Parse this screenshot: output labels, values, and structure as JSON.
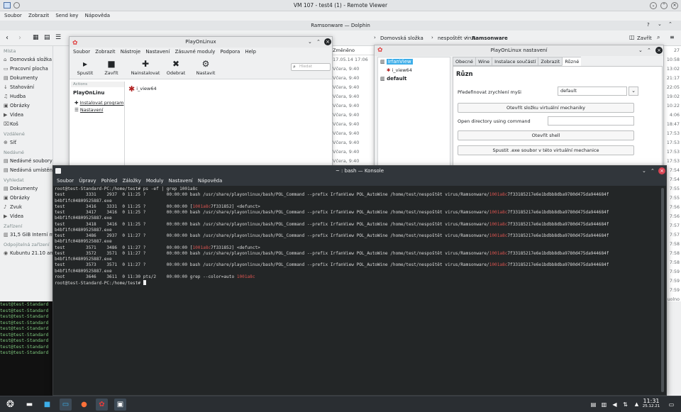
{
  "remote_viewer": {
    "title": "VM 107 - test4 (1) - Remote Viewer",
    "menu": [
      "Soubor",
      "Zobrazit",
      "Send key",
      "Nápověda"
    ]
  },
  "dolphin": {
    "title": "Ramsonware — Dolphin",
    "breadcrumb": [
      "Domovská složka",
      "nespoštět virus",
      "Ramsonware"
    ],
    "close_label": "Zavřít",
    "column_header": "Změněno",
    "sidebar": {
      "places_heading": "Místa",
      "places": [
        "Domovská složka",
        "Pracovní plocha",
        "Dokumenty",
        "Stahování",
        "Hudba",
        "Obrázky",
        "Videa",
        "Koš"
      ],
      "remote_heading": "Vzdálené",
      "remote": [
        "Síť"
      ],
      "recent_heading": "Nedávné",
      "recent": [
        "Nedávné soubory",
        "Nedávná umístění"
      ],
      "search_heading": "Vyhledat",
      "search": [
        "Dokumenty",
        "Obrázky",
        "Zvuk",
        "Videa"
      ],
      "devices_heading": "Zařízení",
      "devices": [
        "31,5 GiB Interní m"
      ],
      "removable_heading": "Odpojitelná zařízení",
      "removable": [
        "Kubuntu 21.10 am"
      ]
    },
    "modified_dates": [
      "17.05.14 17:06",
      "Včera, 9:40",
      "Včera, 9:40",
      "Včera, 9:40",
      "Včera, 9:40",
      "Včera, 9:40",
      "Včera, 9:40",
      "Včera, 9:40",
      "Včera, 9:40",
      "Včera, 9:40",
      "Včera, 9:40",
      "Včera, 9:40",
      "Včera, 9:40"
    ],
    "right_times": [
      "27",
      "10:58",
      "13:02",
      "21:17",
      "22:05",
      "19:02",
      "10:22",
      "4:06",
      "18:47",
      "17:53",
      "17:53",
      "17:53",
      "17:53",
      "7:54",
      "7:54",
      "7:55",
      "7:55",
      "7:56",
      "7:56",
      "7:57",
      "7:57",
      "7:58",
      "7:58",
      "7:58",
      "7:59",
      "7:59",
      "7:59",
      "uolno"
    ]
  },
  "playonlinux": {
    "title": "PlayOnLinux",
    "menu": [
      "Soubor",
      "Zobrazit",
      "Nástroje",
      "Nastavení",
      "Zásuvné moduly",
      "Podpora",
      "Help"
    ],
    "toolbar": [
      "Spustit",
      "Zavřít",
      "Nainstalovat",
      "Odebrat",
      "Nastavit"
    ],
    "search_placeholder": "Hledat",
    "actions_label": "Actions",
    "panel_title": "PlayOnLinu",
    "links": [
      "Instalovat program",
      "Nastavení"
    ],
    "apps": [
      "i_view64"
    ]
  },
  "playonlinux_settings": {
    "title": "PlayOnLinux nastavení",
    "tree": [
      "IrfanView",
      "i_view64",
      "default"
    ],
    "tabs": [
      "Obecné",
      "Wine",
      "Instalace součástí",
      "Zobrazit",
      "Různé"
    ],
    "heading": "Různ",
    "mouse_label": "Předefinovat zrychlení myši",
    "mouse_value": "default",
    "open_folder_button": "Otevřít složku virtuální mechaniky",
    "open_dir_label": "Open directory using command",
    "open_dir_value": "",
    "open_shell_button": "Otevřít shell",
    "run_exe_button": "Spustit .exe soubor v této virtuální mechanice"
  },
  "konsole": {
    "title": "~ : bash — Konsole",
    "menu": [
      "Soubor",
      "Úpravy",
      "Pohled",
      "Záložky",
      "Moduly",
      "Nastavení",
      "Nápověda"
    ],
    "lines": [
      [
        {
          "t": "root@test-Standard-PC:/home/test# ps -ef | grep 1001a8c"
        }
      ],
      [
        {
          "t": "test        3331    2937  0 11:25 ?        00:00:00 bash /usr/share/playonlinux/bash/POL_Command --prefix IrfanView POL_AutoWine /home/test/nespoštět virus/Ramsonware/"
        },
        {
          "t": "1001a8c",
          "r": 1
        },
        {
          "t": "7f33185217e6e1bdbb8dba9780d475da944684f"
        }
      ],
      [
        {
          "t": "b4bf1fc04809525887.exe"
        }
      ],
      [
        {
          "t": "test        3416    3331  0 11:25 ?        00:00:00 ["
        },
        {
          "t": "1001a8c",
          "r": 1
        },
        {
          "t": "7f331852] <defunct>"
        }
      ],
      [
        {
          "t": "test        3417    3416  0 11:25 ?        00:00:00 bash /usr/share/playonlinux/bash/POL_Command --prefix IrfanView POL_AutoWine /home/test/nespoštět virus/Ramsonware/"
        },
        {
          "t": "1001a8c",
          "r": 1
        },
        {
          "t": "7f33185217e6e1bdbb8dba9780d475da944684f"
        }
      ],
      [
        {
          "t": "b4bf1fc04809525887.exe"
        }
      ],
      [
        {
          "t": "test        3418    3416  0 11:25 ?        00:00:00 bash /usr/share/playonlinux/bash/POL_Command --prefix IrfanView POL_AutoWine /home/test/nespoštět virus/Ramsonware/"
        },
        {
          "t": "1001a8c",
          "r": 1
        },
        {
          "t": "7f33185217e6e1bdbb8dba9780d475da944684f"
        }
      ],
      [
        {
          "t": "b4bf1fc04809525887.exe"
        }
      ],
      [
        {
          "t": "test        3486    2937  0 11:27 ?        00:00:00 bash /usr/share/playonlinux/bash/POL_Command --prefix IrfanView POL_AutoWine /home/test/nespoštět virus/Ramsonware/"
        },
        {
          "t": "1001a8c",
          "r": 1
        },
        {
          "t": "7f33185217e6e1bdbb8dba9780d475da944684f"
        }
      ],
      [
        {
          "t": "b4bf1fc04809525887.exe"
        }
      ],
      [
        {
          "t": "test        3571    3486  0 11:27 ?        00:00:00 ["
        },
        {
          "t": "1001a8c",
          "r": 1
        },
        {
          "t": "7f331852] <defunct>"
        }
      ],
      [
        {
          "t": "test        3572    3571  0 11:27 ?        00:00:00 bash /usr/share/playonlinux/bash/POL_Command --prefix IrfanView POL_AutoWine /home/test/nespoštět virus/Ramsonware/"
        },
        {
          "t": "1001a8c",
          "r": 1
        },
        {
          "t": "7f33185217e6e1bdbb8dba9780d475da944684f"
        }
      ],
      [
        {
          "t": "b4bf1fc04809525887.exe"
        }
      ],
      [
        {
          "t": "test        3573    3571  0 11:27 ?        00:00:00 bash /usr/share/playonlinux/bash/POL_Command --prefix IrfanView POL_AutoWine /home/test/nespoštět virus/Ramsonware/"
        },
        {
          "t": "1001a8c",
          "r": 1
        },
        {
          "t": "7f33185217e6e1bdbb8dba9780d475da944684f"
        }
      ],
      [
        {
          "t": "b4bf1fc04809525887.exe"
        }
      ],
      [
        {
          "t": "root        3646    3611  0 11:30 pts/2    00:00:00 grep --color=auto "
        },
        {
          "t": "1001a8c",
          "r": 1
        }
      ],
      [
        {
          "t": "root@test-Standard-PC:/home/test# "
        }
      ]
    ]
  },
  "xterm_lines": [
    "test@test-Standard",
    "test@test-Standard",
    "test@test-Standard",
    "test@test-Standard",
    "test@test-Standard",
    "test@test-Standard",
    "test@test-Standard",
    "test@test-Standard",
    "test@test-Standard"
  ],
  "taskbar": {
    "time": "11:31",
    "date": "25.12.21"
  },
  "colors": {
    "terminal_bg": "#232627",
    "highlight_red": "#d9534f",
    "panel_bg": "#2a2e32"
  }
}
